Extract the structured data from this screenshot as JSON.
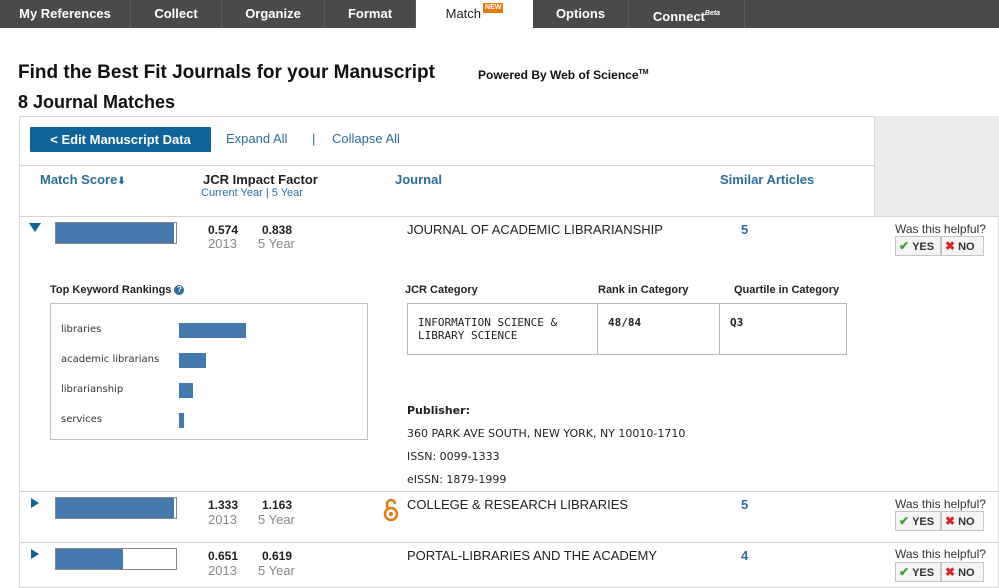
{
  "nav": {
    "tabs": [
      "My References",
      "Collect",
      "Organize",
      "Format",
      "Match",
      "Options",
      "Connect"
    ],
    "match_badge": "NEW",
    "connect_sup": "Beta"
  },
  "header": {
    "title": "Find the Best Fit Journals for your Manuscript",
    "powered": "Powered By Web of Science",
    "powered_tm": "TM",
    "count": "8 Journal Matches"
  },
  "toolbar": {
    "edit_label": "< Edit Manuscript Data",
    "expand_label": "Expand All",
    "separator": "|",
    "collapse_label": "Collapse All"
  },
  "columns": {
    "match_score": "Match Score",
    "sort_arrow": "⬇",
    "jcr": "JCR Impact Factor",
    "current_year": "Current Year",
    "sep": "|",
    "five_year": "5 Year",
    "journal": "Journal",
    "similar": "Similar Articles"
  },
  "helpful": {
    "label": "Was this helpful?",
    "yes": "YES",
    "no": "NO"
  },
  "rows": [
    {
      "score_fraction": 0.98,
      "if_current": "0.574",
      "if_current_label": "2013",
      "if_five": "0.838",
      "if_five_label": "5 Year",
      "journal": "JOURNAL OF ACADEMIC LIBRARIANSHIP",
      "similar": "5",
      "open_access": false,
      "expanded": true
    },
    {
      "score_fraction": 0.98,
      "if_current": "1.333",
      "if_current_label": "2013",
      "if_five": "1.163",
      "if_five_label": "5 Year",
      "journal": "COLLEGE & RESEARCH LIBRARIES",
      "similar": "5",
      "open_access": true,
      "expanded": false
    },
    {
      "score_fraction": 0.56,
      "if_current": "0.651",
      "if_current_label": "2013",
      "if_five": "0.619",
      "if_five_label": "5 Year",
      "journal": "PORTAL-LIBRARIES AND THE ACADEMY",
      "similar": "4",
      "open_access": false,
      "expanded": false
    }
  ],
  "detail": {
    "kw_title": "Top Keyword Rankings",
    "kw_help": "?",
    "keywords": [
      {
        "label": "libraries",
        "value": 1.0
      },
      {
        "label": "academic librarians",
        "value": 0.4
      },
      {
        "label": "librarianship",
        "value": 0.21
      },
      {
        "label": "services",
        "value": 0.08
      }
    ],
    "jcr_category_title": "JCR Category",
    "rank_title": "Rank in Category",
    "quartile_title": "Quartile in Category",
    "category_line1": "INFORMATION SCIENCE &",
    "category_line2": "LIBRARY SCIENCE",
    "rank": "48/84",
    "quartile": "Q3",
    "publisher_title": "Publisher:",
    "publisher_address": "360 PARK AVE SOUTH, NEW YORK, NY 10010-1710",
    "issn": "ISSN: 0099-1333",
    "eissn": "eISSN: 1879-1999"
  },
  "colors": {
    "nav_bg": "#4a4a4a",
    "accent": "#0e6399",
    "bar": "#4479ad",
    "link": "#2a6f9b",
    "badge": "#e8790f",
    "oa": "#e8790f"
  }
}
